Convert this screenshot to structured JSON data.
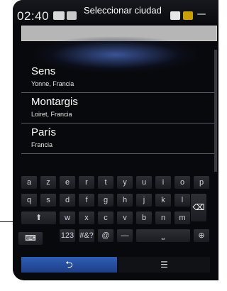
{
  "status_bar": {
    "time": "02:40",
    "title": "Seleccionar ciudad"
  },
  "cities": [
    {
      "name": "Sens",
      "region": "Yonne, Francia"
    },
    {
      "name": "Montargis",
      "region": "Loiret, Francia"
    },
    {
      "name": "París",
      "region": "Francia"
    }
  ],
  "keyboard": {
    "row1": [
      "a",
      "z",
      "e",
      "r",
      "t",
      "y",
      "u",
      "i",
      "o",
      "p"
    ],
    "row2": [
      "q",
      "s",
      "d",
      "f",
      "g",
      "h",
      "j",
      "k",
      "l"
    ],
    "row3_shift": "⬆",
    "row3": [
      "w",
      "x",
      "c",
      "v",
      "b",
      "n",
      "m"
    ],
    "backspace": "⌫",
    "row4": [
      "123",
      "#&?",
      "@",
      "—"
    ],
    "space": "⎵",
    "globe": "⊕",
    "keyboard_icon": "⌨"
  },
  "bottom": {
    "back": "⮌",
    "menu": "☰"
  }
}
